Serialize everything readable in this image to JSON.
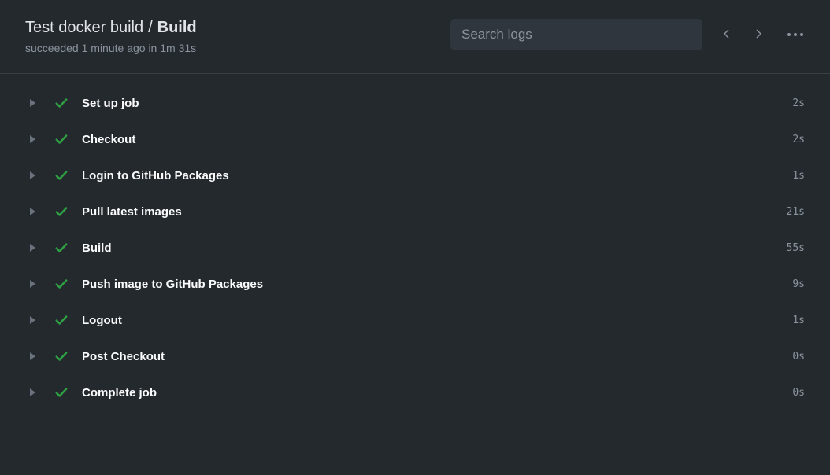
{
  "header": {
    "workflow_name": "Test docker build",
    "separator": "/",
    "job_name": "Build",
    "subtitle": "succeeded 1 minute ago in 1m 31s"
  },
  "search": {
    "placeholder": "Search logs"
  },
  "steps": [
    {
      "name": "Set up job",
      "duration": "2s"
    },
    {
      "name": "Checkout",
      "duration": "2s"
    },
    {
      "name": "Login to GitHub Packages",
      "duration": "1s"
    },
    {
      "name": "Pull latest images",
      "duration": "21s"
    },
    {
      "name": "Build",
      "duration": "55s"
    },
    {
      "name": "Push image to GitHub Packages",
      "duration": "9s"
    },
    {
      "name": "Logout",
      "duration": "1s"
    },
    {
      "name": "Post Checkout",
      "duration": "0s"
    },
    {
      "name": "Complete job",
      "duration": "0s"
    }
  ]
}
